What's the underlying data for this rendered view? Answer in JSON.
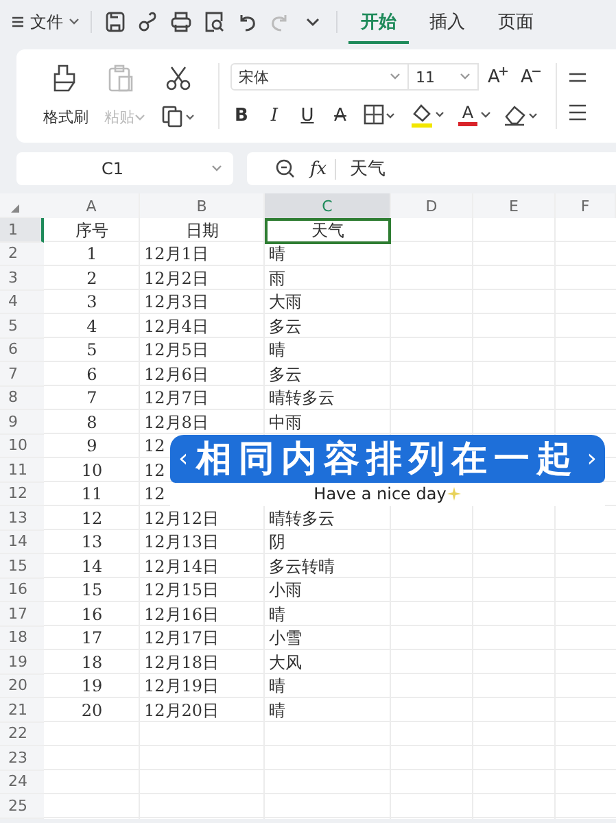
{
  "menu": {
    "label": "文件"
  },
  "quick_tools": [
    {
      "kind": "save",
      "disabled": false
    },
    {
      "kind": "link",
      "disabled": false
    },
    {
      "kind": "print",
      "disabled": false
    },
    {
      "kind": "preview",
      "disabled": false
    },
    {
      "kind": "undo",
      "disabled": false
    },
    {
      "kind": "redo",
      "disabled": true
    },
    {
      "kind": "more",
      "disabled": false
    }
  ],
  "tabs": [
    {
      "label": "开始",
      "selected": true
    },
    {
      "label": "插入",
      "selected": false
    },
    {
      "label": "页面",
      "selected": false
    }
  ],
  "clipboard": {
    "format_painter": "格式刷",
    "paste": {
      "label": "粘贴",
      "disabled": true
    }
  },
  "font": {
    "name": "宋体",
    "size": "11"
  },
  "size_buttons": [
    {
      "kind": "grow",
      "label": "A"
    },
    {
      "kind": "shrink",
      "label": "A"
    }
  ],
  "format_buttons": [
    {
      "kind": "bold",
      "label": "B"
    },
    {
      "kind": "italic",
      "label": "I"
    },
    {
      "kind": "underline",
      "label": "U"
    },
    {
      "kind": "strike",
      "label": "A"
    }
  ],
  "color_tools": [
    {
      "kind": "borders"
    },
    {
      "kind": "fill",
      "color": "#f2e600"
    },
    {
      "kind": "font_color",
      "label": "A",
      "color": "#d9232a"
    },
    {
      "kind": "clear"
    }
  ],
  "name_box": "C1",
  "formula": {
    "fx": "fx",
    "value": "天气"
  },
  "columns": [
    {
      "label": "A",
      "selected": false
    },
    {
      "label": "B",
      "selected": false
    },
    {
      "label": "C",
      "selected": true
    },
    {
      "label": "D",
      "selected": false
    },
    {
      "label": "E",
      "selected": false
    },
    {
      "label": "F",
      "selected": false
    }
  ],
  "rows": [
    {
      "num": "1",
      "selected": true,
      "cells": [
        "序号",
        "日期",
        "天气"
      ]
    },
    {
      "num": "2",
      "selected": false,
      "cells": [
        "1",
        "12月1日",
        "晴"
      ]
    },
    {
      "num": "3",
      "selected": false,
      "cells": [
        "2",
        "12月2日",
        "雨"
      ]
    },
    {
      "num": "4",
      "selected": false,
      "cells": [
        "3",
        "12月3日",
        "大雨"
      ]
    },
    {
      "num": "5",
      "selected": false,
      "cells": [
        "4",
        "12月4日",
        "多云"
      ]
    },
    {
      "num": "6",
      "selected": false,
      "cells": [
        "5",
        "12月5日",
        "晴"
      ]
    },
    {
      "num": "7",
      "selected": false,
      "cells": [
        "6",
        "12月6日",
        "多云"
      ]
    },
    {
      "num": "8",
      "selected": false,
      "cells": [
        "7",
        "12月7日",
        "晴转多云"
      ]
    },
    {
      "num": "9",
      "selected": false,
      "cells": [
        "8",
        "12月8日",
        "中雨"
      ]
    },
    {
      "num": "10",
      "selected": false,
      "cells": [
        "9",
        "12"
      ]
    },
    {
      "num": "11",
      "selected": false,
      "cells": [
        "10",
        "12"
      ]
    },
    {
      "num": "12",
      "selected": false,
      "cells": [
        "11",
        "12"
      ]
    },
    {
      "num": "13",
      "selected": false,
      "cells": [
        "12",
        "12月12日",
        "晴转多云"
      ]
    },
    {
      "num": "14",
      "selected": false,
      "cells": [
        "13",
        "12月13日",
        "阴"
      ]
    },
    {
      "num": "15",
      "selected": false,
      "cells": [
        "14",
        "12月14日",
        "多云转晴"
      ]
    },
    {
      "num": "16",
      "selected": false,
      "cells": [
        "15",
        "12月15日",
        "小雨"
      ]
    },
    {
      "num": "17",
      "selected": false,
      "cells": [
        "16",
        "12月16日",
        "晴"
      ]
    },
    {
      "num": "18",
      "selected": false,
      "cells": [
        "17",
        "12月17日",
        "小雪"
      ]
    },
    {
      "num": "19",
      "selected": false,
      "cells": [
        "18",
        "12月18日",
        "大风"
      ]
    },
    {
      "num": "20",
      "selected": false,
      "cells": [
        "19",
        "12月19日",
        "晴"
      ]
    },
    {
      "num": "21",
      "selected": false,
      "cells": [
        "20",
        "12月20日",
        "晴"
      ]
    },
    {
      "num": "22",
      "selected": false,
      "cells": []
    },
    {
      "num": "23",
      "selected": false,
      "cells": []
    },
    {
      "num": "24",
      "selected": false,
      "cells": []
    },
    {
      "num": "25",
      "selected": false,
      "cells": []
    }
  ],
  "overlay": {
    "prev": "‹",
    "title": "相同内容排列在一起",
    "next": "›",
    "caption": "Have a nice day"
  }
}
